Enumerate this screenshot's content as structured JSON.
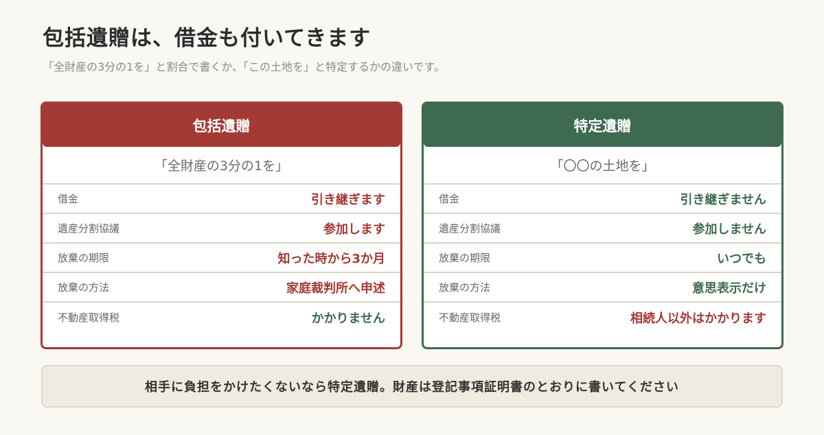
{
  "title": "包括遺贈は、借金も付いてきます",
  "subtitle": "「全財産の3分の1を」と割合で書くか、「この土地を」と特定するかの違いです。",
  "colors": {
    "red": "#a33a35",
    "green": "#3e6a50"
  },
  "cards": [
    {
      "heading": "包括遺贈",
      "example": "「全財産の3分の1を」",
      "rows": [
        {
          "label": "借金",
          "value": "引き継ぎます",
          "tone": "red"
        },
        {
          "label": "遺産分割協議",
          "value": "参加します",
          "tone": "red"
        },
        {
          "label": "放棄の期限",
          "value": "知った時から3か月",
          "tone": "red"
        },
        {
          "label": "放棄の方法",
          "value": "家庭裁判所へ申述",
          "tone": "red"
        },
        {
          "label": "不動産取得税",
          "value": "かかりません",
          "tone": "green"
        }
      ]
    },
    {
      "heading": "特定遺贈",
      "example": "「〇〇の土地を」",
      "rows": [
        {
          "label": "借金",
          "value": "引き継ぎません",
          "tone": "green"
        },
        {
          "label": "遺産分割協議",
          "value": "参加しません",
          "tone": "green"
        },
        {
          "label": "放棄の期限",
          "value": "いつでも",
          "tone": "green"
        },
        {
          "label": "放棄の方法",
          "value": "意思表示だけ",
          "tone": "green"
        },
        {
          "label": "不動産取得税",
          "value": "相続人以外はかかります",
          "tone": "red"
        }
      ]
    }
  ],
  "note": "相手に負担をかけたくないなら特定遺贈。財産は登記事項証明書のとおりに書いてください"
}
